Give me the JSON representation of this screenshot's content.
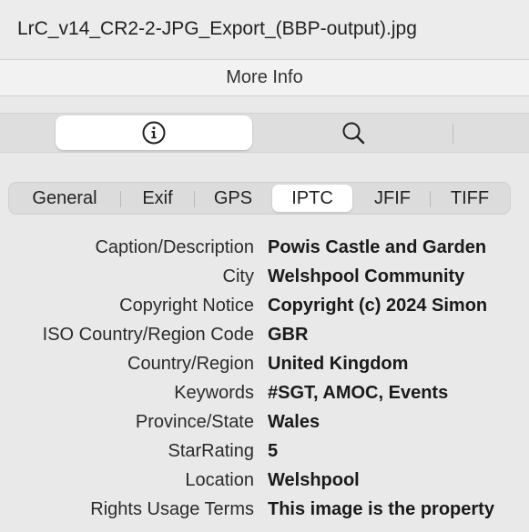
{
  "window": {
    "title": "LrC_v14_CR2-2-JPG_Export_(BBP-output).jpg"
  },
  "panel": {
    "header": "More Info"
  },
  "toolbar": {
    "buttons": [
      {
        "icon": "info-circle-icon",
        "selected": true
      },
      {
        "icon": "magnifier-icon",
        "selected": false
      }
    ]
  },
  "tabs": [
    {
      "label": "General"
    },
    {
      "label": "Exif"
    },
    {
      "label": "GPS"
    },
    {
      "label": "IPTC",
      "active": true
    },
    {
      "label": "JFIF"
    },
    {
      "label": "TIFF"
    }
  ],
  "fields": [
    {
      "label": "Caption/Description",
      "value": "Powis Castle and Garden"
    },
    {
      "label": "City",
      "value": "Welshpool Community"
    },
    {
      "label": "Copyright Notice",
      "value": "Copyright (c) 2024 Simon"
    },
    {
      "label": "ISO Country/Region Code",
      "value": "GBR"
    },
    {
      "label": "Country/Region",
      "value": "United Kingdom"
    },
    {
      "label": "Keywords",
      "value": "#SGT, AMOC, Events"
    },
    {
      "label": "Province/State",
      "value": "Wales"
    },
    {
      "label": "StarRating",
      "value": "5"
    },
    {
      "label": "Location",
      "value": "Welshpool"
    },
    {
      "label": "Rights Usage Terms",
      "value": "This image is the property"
    }
  ]
}
